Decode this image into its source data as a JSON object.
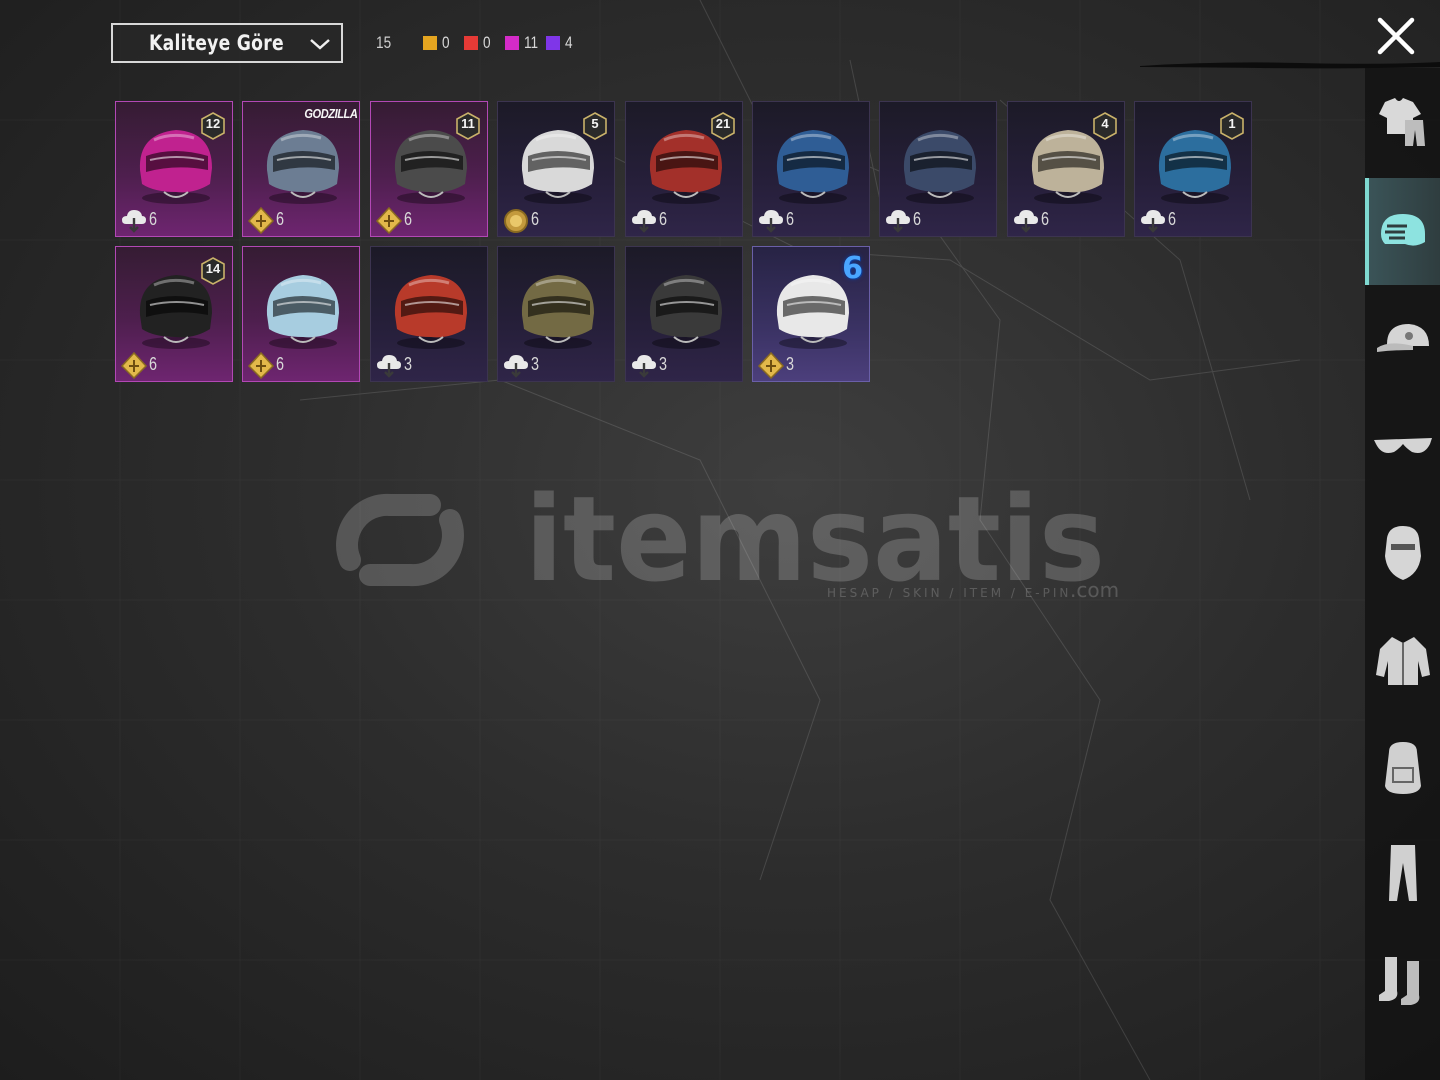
{
  "sort": {
    "label": "Kaliteye Göre"
  },
  "counts": {
    "total": "15",
    "quality": [
      {
        "color": "#e5a520",
        "value": "0"
      },
      {
        "color": "#e63a36",
        "value": "0"
      },
      {
        "color": "#d42bc8",
        "value": "11"
      },
      {
        "color": "#7f36e8",
        "value": "4"
      }
    ]
  },
  "sidebar": {
    "items": [
      {
        "name": "outfit",
        "icon": "outfit-icon"
      },
      {
        "name": "helmet",
        "icon": "helmet-icon",
        "active": true
      },
      {
        "name": "hat",
        "icon": "cap-icon"
      },
      {
        "name": "glasses",
        "icon": "glasses-icon"
      },
      {
        "name": "mask",
        "icon": "mask-icon"
      },
      {
        "name": "jacket",
        "icon": "jacket-icon"
      },
      {
        "name": "backpack",
        "icon": "backpack-icon"
      },
      {
        "name": "pants",
        "icon": "pants-icon"
      },
      {
        "name": "boots",
        "icon": "boots-icon"
      }
    ]
  },
  "items": [
    {
      "rarity": "purple",
      "badge": "12",
      "level": "6",
      "level_icon": "cloud-icon",
      "helmet_color": "#c0228f"
    },
    {
      "rarity": "purple",
      "logo": "GODZILLA",
      "level": "6",
      "level_icon": "gold-diamond-icon",
      "helmet_color": "#6c7d93"
    },
    {
      "rarity": "purple",
      "badge": "11",
      "level": "6",
      "level_icon": "gold-diamond-icon",
      "helmet_color": "#4b4b4b"
    },
    {
      "rarity": "dark",
      "badge": "5",
      "level": "6",
      "level_icon": "gold-coin-icon",
      "helmet_color": "#d9d9d9"
    },
    {
      "rarity": "dark",
      "badge": "21",
      "level": "6",
      "level_icon": "cloud-icon",
      "helmet_color": "#a3302a"
    },
    {
      "rarity": "dark",
      "level": "6",
      "level_icon": "cloud-icon",
      "helmet_color": "#2f5d95"
    },
    {
      "rarity": "dark",
      "level": "6",
      "level_icon": "cloud-icon",
      "helmet_color": "#3b4a69"
    },
    {
      "rarity": "dark",
      "badge": "4",
      "level": "6",
      "level_icon": "cloud-icon",
      "helmet_color": "#bdb29a"
    },
    {
      "rarity": "dark",
      "badge": "1",
      "level": "6",
      "level_icon": "cloud-icon",
      "helmet_color": "#2c6e9e"
    },
    {
      "rarity": "purple",
      "badge": "14",
      "level": "6",
      "level_icon": "gold-diamond-icon",
      "helmet_color": "#222222"
    },
    {
      "rarity": "purple",
      "level": "6",
      "level_icon": "gold-diamond-icon",
      "helmet_color": "#a7cde0"
    },
    {
      "rarity": "dark",
      "level": "3",
      "level_icon": "cloud-icon",
      "helmet_color": "#b83a2a"
    },
    {
      "rarity": "dark",
      "level": "3",
      "level_icon": "cloud-icon",
      "helmet_color": "#736a44"
    },
    {
      "rarity": "dark",
      "level": "3",
      "level_icon": "cloud-icon",
      "helmet_color": "#3a3a3a"
    },
    {
      "rarity": "blue",
      "big_badge": "6",
      "level": "3",
      "level_icon": "gold-diamond-icon",
      "helmet_color": "#e8e8e8"
    }
  ],
  "watermark": {
    "brand": "itemsatis",
    "tagline": "HESAP / SKIN / ITEM / E-PIN",
    "suffix": ".com"
  }
}
